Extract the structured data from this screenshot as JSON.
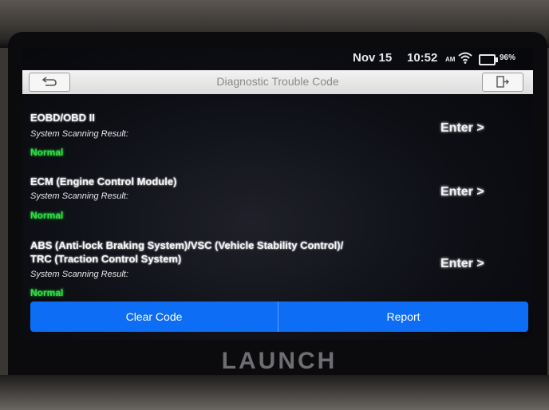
{
  "status_bar": {
    "date": "Nov 15",
    "time": "10:52",
    "ampm": "AM",
    "battery": "96%"
  },
  "header": {
    "title": "Diagnostic Trouble Code",
    "back_icon": "back-arrow-icon",
    "exit_icon": "exit-icon"
  },
  "systems": [
    {
      "name": "EOBD/OBD II",
      "result_label": "System Scanning Result:",
      "result": "Normal",
      "enter": "Enter >"
    },
    {
      "name": "ECM (Engine Control Module)",
      "result_label": "System Scanning Result:",
      "result": "Normal",
      "enter": "Enter >"
    },
    {
      "name_line1": "ABS (Anti-lock Braking System)/VSC (Vehicle Stability Control)/",
      "name_line2": "TRC (Traction Control System)",
      "result_label": "System Scanning Result:",
      "result": "Normal",
      "enter": "Enter >"
    }
  ],
  "actions": {
    "clear_code": "Clear Code",
    "report": "Report"
  },
  "brand": "LAUNCH",
  "colors": {
    "accent": "#0d6df5",
    "normal_status": "#2fe04a"
  }
}
